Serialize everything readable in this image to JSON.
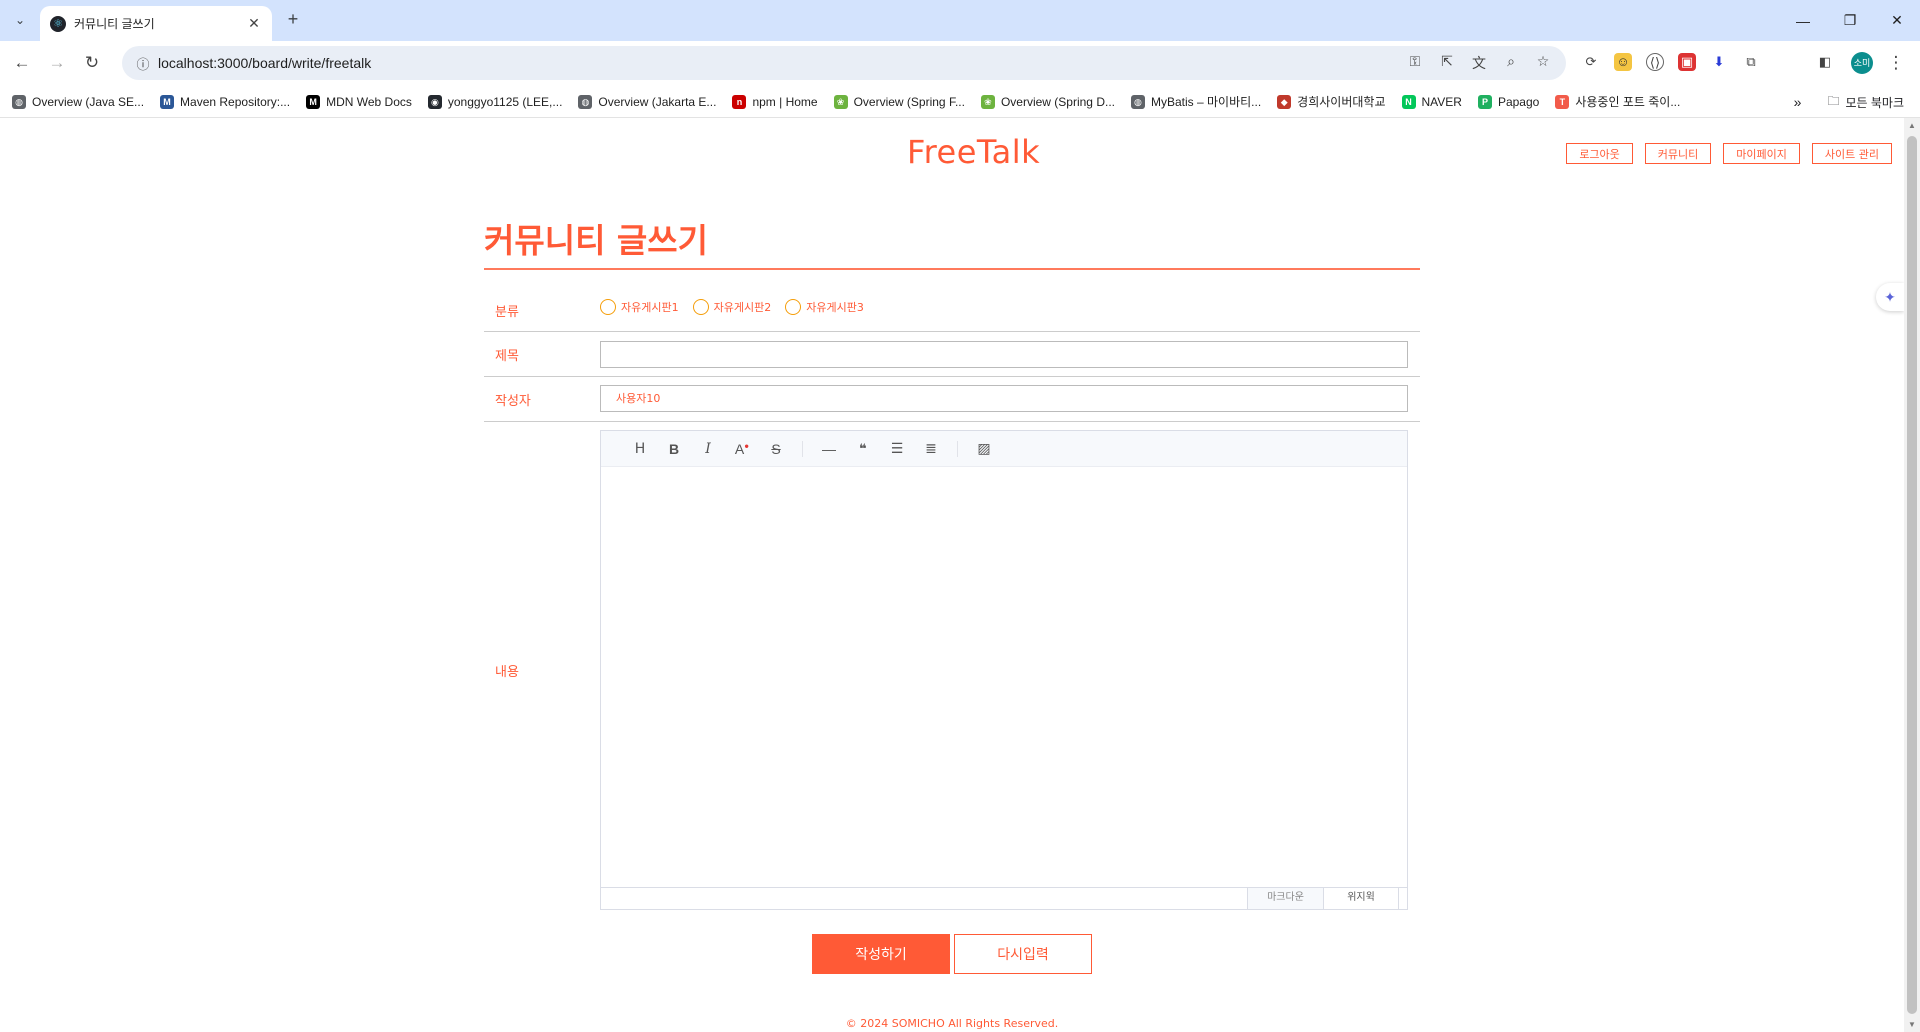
{
  "browser": {
    "tab_title": "커뮤니티 글쓰기",
    "url": "localhost:3000/board/write/freetalk",
    "profile_initials": "소미",
    "bookmarks": [
      {
        "label": "Overview (Java SE...",
        "icon": "globe-icon",
        "color": "#5f6368"
      },
      {
        "label": "Maven Repository:...",
        "icon": "maven-icon",
        "color": "#2b5797"
      },
      {
        "label": "MDN Web Docs",
        "icon": "mdn-icon",
        "color": "#000000"
      },
      {
        "label": "yonggyo1125 (LEE,...",
        "icon": "github-icon",
        "color": "#24292f"
      },
      {
        "label": "Overview (Jakarta E...",
        "icon": "globe-icon",
        "color": "#5f6368"
      },
      {
        "label": "npm | Home",
        "icon": "npm-icon",
        "color": "#cb0000"
      },
      {
        "label": "Overview (Spring F...",
        "icon": "spring-icon",
        "color": "#6db33f"
      },
      {
        "label": "Overview (Spring D...",
        "icon": "spring-icon",
        "color": "#6db33f"
      },
      {
        "label": "MyBatis – 마이바티...",
        "icon": "globe-icon",
        "color": "#5f6368"
      },
      {
        "label": "경희사이버대학교",
        "icon": "university-icon",
        "color": "#c0392b"
      },
      {
        "label": "NAVER",
        "icon": "naver-icon",
        "color": "#03c75a"
      },
      {
        "label": "Papago",
        "icon": "papago-icon",
        "color": "#20b060"
      },
      {
        "label": "사용중인 포트 죽이...",
        "icon": "tistory-icon",
        "color": "#f25b4a"
      }
    ],
    "all_bookmarks": "모든 북마크"
  },
  "header": {
    "logo": "FreeTalk",
    "nav": [
      "로그아웃",
      "커뮤니티",
      "마이페이지",
      "사이트 관리"
    ]
  },
  "form": {
    "page_title": "커뮤니티 글쓰기",
    "category_label": "분류",
    "categories": [
      "자유게시판1",
      "자유게시판2",
      "자유게시판3"
    ],
    "subject_label": "제목",
    "subject_value": "",
    "poster_label": "작성자",
    "poster_value": "사용자10",
    "content_label": "내용",
    "editor_modes": [
      "마크다운",
      "위지윅"
    ],
    "submit": "작성하기",
    "reset": "다시입력"
  },
  "footer": "© 2024 SOMICHO All Rights Reserved.",
  "colors": {
    "accent": "#ff5a36",
    "radio_border": "#f59e0b"
  }
}
